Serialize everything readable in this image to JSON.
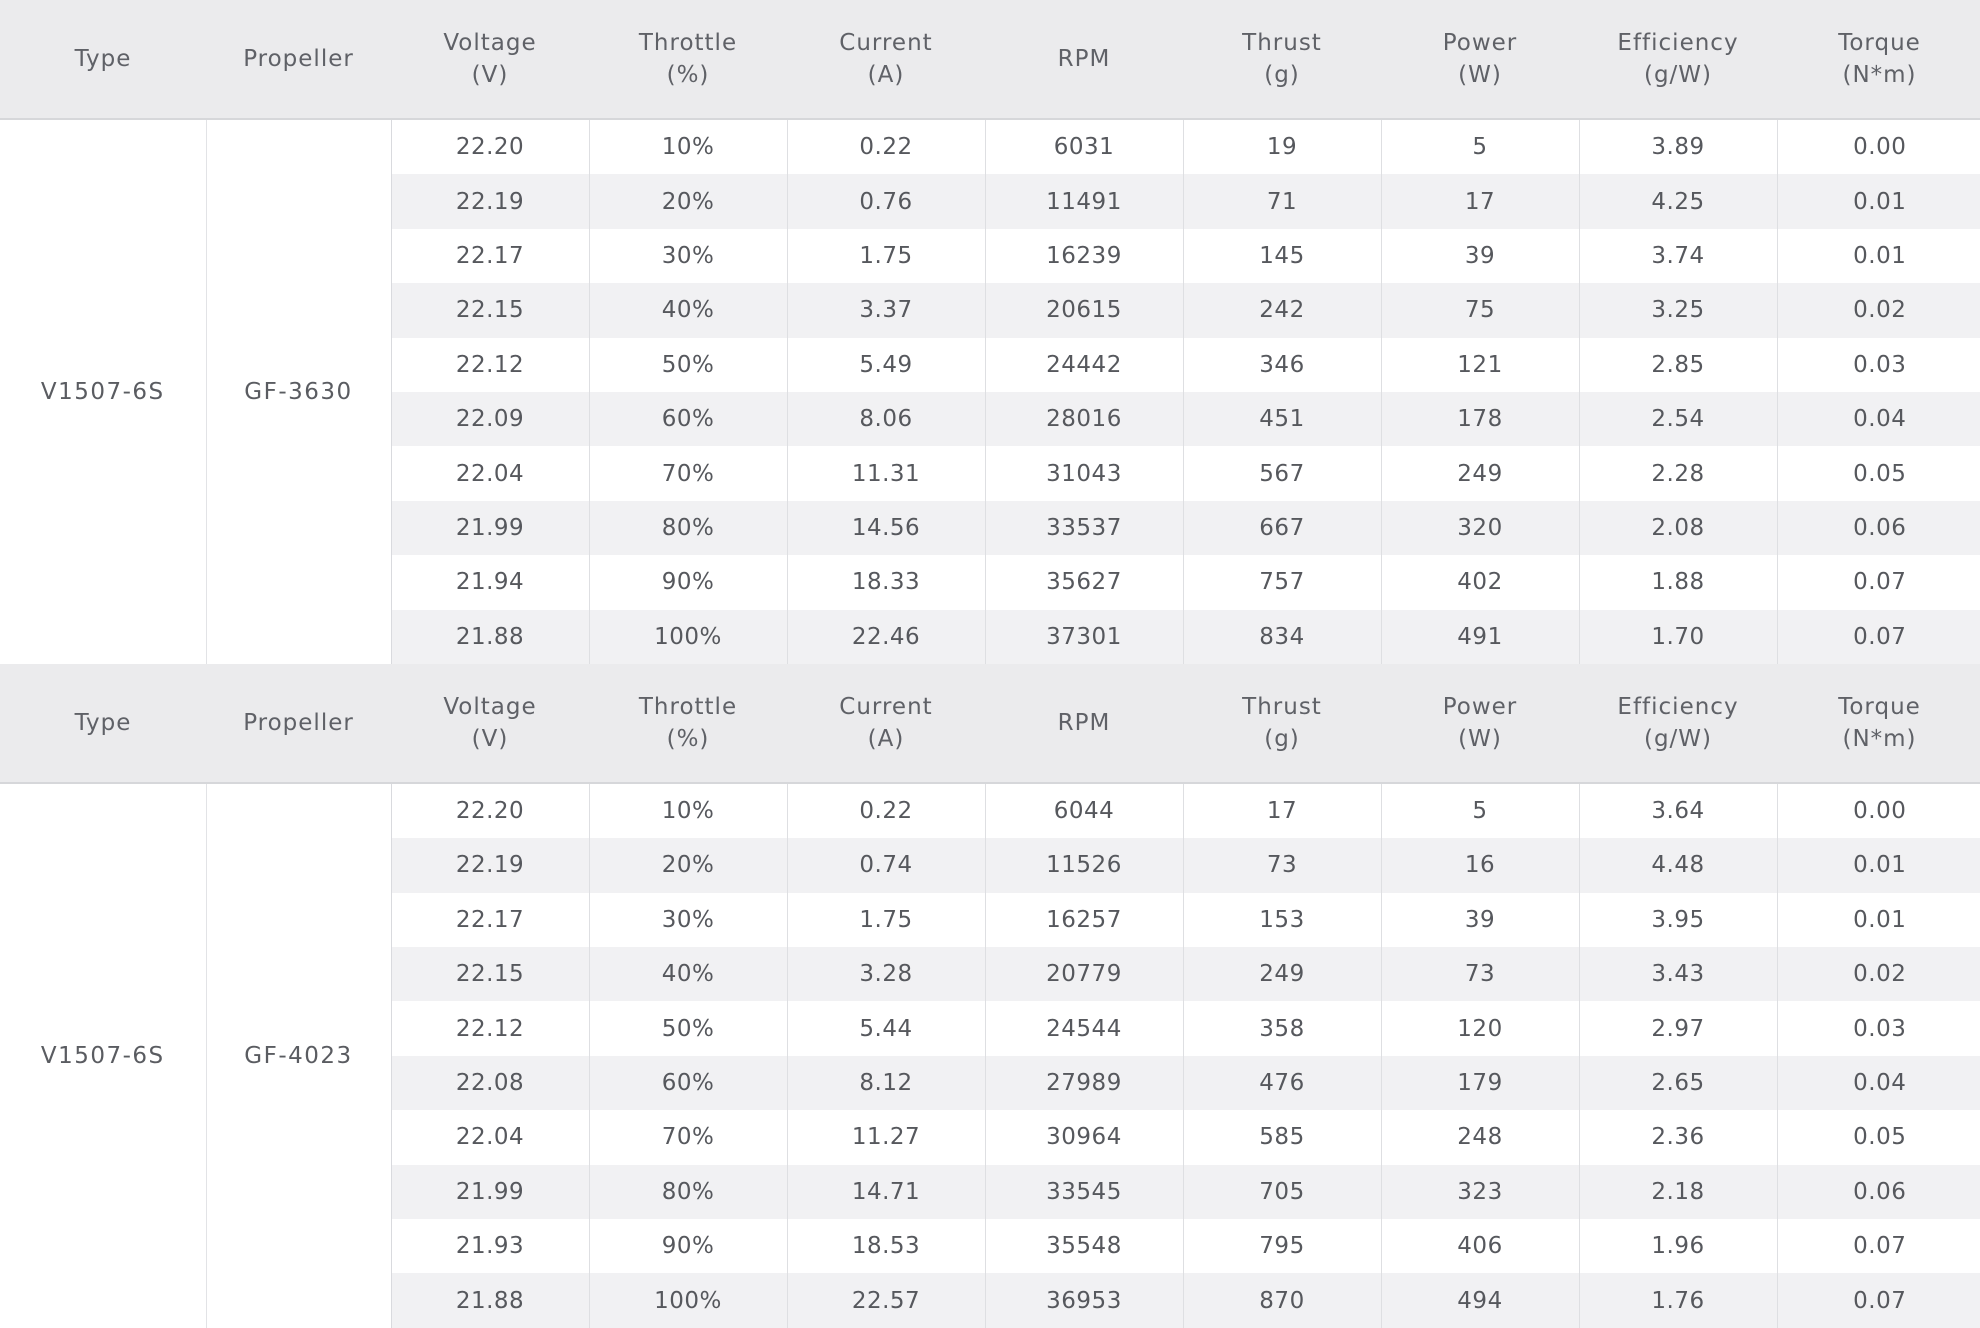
{
  "headers": [
    {
      "l1": "Type",
      "l2": ""
    },
    {
      "l1": "Propeller",
      "l2": ""
    },
    {
      "l1": "Voltage",
      "l2": "(V)"
    },
    {
      "l1": "Throttle",
      "l2": "(%)"
    },
    {
      "l1": "Current",
      "l2": "(A)"
    },
    {
      "l1": "RPM",
      "l2": ""
    },
    {
      "l1": "Thrust",
      "l2": "(g)"
    },
    {
      "l1": "Power",
      "l2": "(W)"
    },
    {
      "l1": "Efficiency",
      "l2": "(g/W)"
    },
    {
      "l1": "Torque",
      "l2": "(N*m)"
    }
  ],
  "sections": [
    {
      "type": "V1507-6S",
      "propeller": "GF-3630",
      "rows": [
        [
          "22.20",
          "10%",
          "0.22",
          "6031",
          "19",
          "5",
          "3.89",
          "0.00"
        ],
        [
          "22.19",
          "20%",
          "0.76",
          "11491",
          "71",
          "17",
          "4.25",
          "0.01"
        ],
        [
          "22.17",
          "30%",
          "1.75",
          "16239",
          "145",
          "39",
          "3.74",
          "0.01"
        ],
        [
          "22.15",
          "40%",
          "3.37",
          "20615",
          "242",
          "75",
          "3.25",
          "0.02"
        ],
        [
          "22.12",
          "50%",
          "5.49",
          "24442",
          "346",
          "121",
          "2.85",
          "0.03"
        ],
        [
          "22.09",
          "60%",
          "8.06",
          "28016",
          "451",
          "178",
          "2.54",
          "0.04"
        ],
        [
          "22.04",
          "70%",
          "11.31",
          "31043",
          "567",
          "249",
          "2.28",
          "0.05"
        ],
        [
          "21.99",
          "80%",
          "14.56",
          "33537",
          "667",
          "320",
          "2.08",
          "0.06"
        ],
        [
          "21.94",
          "90%",
          "18.33",
          "35627",
          "757",
          "402",
          "1.88",
          "0.07"
        ],
        [
          "21.88",
          "100%",
          "22.46",
          "37301",
          "834",
          "491",
          "1.70",
          "0.07"
        ]
      ]
    },
    {
      "type": "V1507-6S",
      "propeller": "GF-4023",
      "rows": [
        [
          "22.20",
          "10%",
          "0.22",
          "6044",
          "17",
          "5",
          "3.64",
          "0.00"
        ],
        [
          "22.19",
          "20%",
          "0.74",
          "11526",
          "73",
          "16",
          "4.48",
          "0.01"
        ],
        [
          "22.17",
          "30%",
          "1.75",
          "16257",
          "153",
          "39",
          "3.95",
          "0.01"
        ],
        [
          "22.15",
          "40%",
          "3.28",
          "20779",
          "249",
          "73",
          "3.43",
          "0.02"
        ],
        [
          "22.12",
          "50%",
          "5.44",
          "24544",
          "358",
          "120",
          "2.97",
          "0.03"
        ],
        [
          "22.08",
          "60%",
          "8.12",
          "27989",
          "476",
          "179",
          "2.65",
          "0.04"
        ],
        [
          "22.04",
          "70%",
          "11.27",
          "30964",
          "585",
          "248",
          "2.36",
          "0.05"
        ],
        [
          "21.99",
          "80%",
          "14.71",
          "33545",
          "705",
          "323",
          "2.18",
          "0.06"
        ],
        [
          "21.93",
          "90%",
          "18.53",
          "35548",
          "795",
          "406",
          "1.96",
          "0.07"
        ],
        [
          "21.88",
          "100%",
          "22.57",
          "36953",
          "870",
          "494",
          "1.76",
          "0.07"
        ]
      ]
    }
  ]
}
